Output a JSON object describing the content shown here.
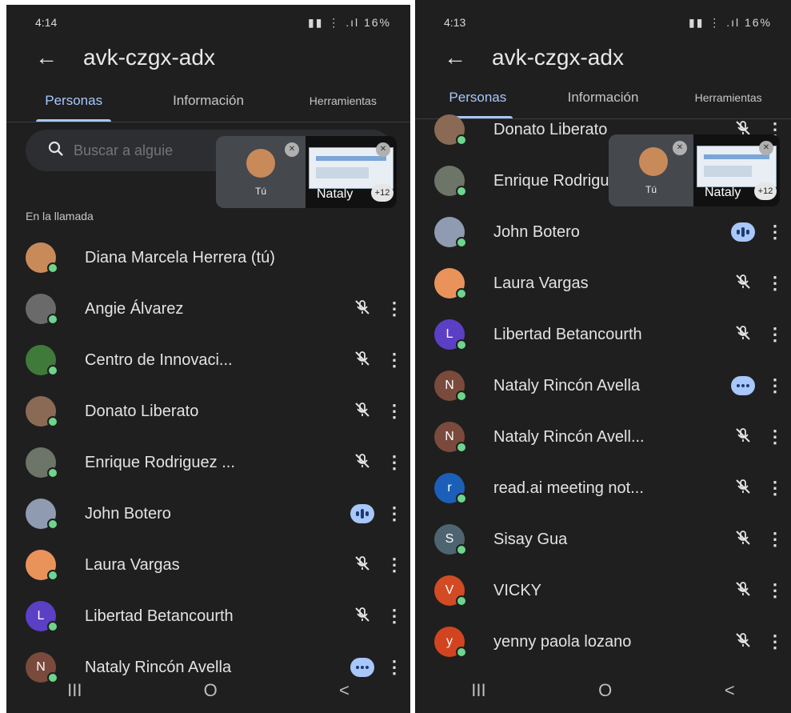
{
  "left": {
    "status": {
      "time": "4:14",
      "battery": "16%"
    },
    "title": "avk-czgx-adx",
    "tabs": [
      "Personas",
      "Información",
      "Herramientas"
    ],
    "search": {
      "placeholder": "Buscar a alguie"
    },
    "pip": {
      "self_label": "Tú",
      "share_name": "Nataly",
      "count": "+12"
    },
    "section_label": "En la llamada",
    "participants": [
      {
        "name": "Diana Marcela Herrera (tú)",
        "initial": "",
        "color": "#c98a5a",
        "state": "none"
      },
      {
        "name": "Angie Álvarez",
        "initial": "",
        "color": "#6a6a6a",
        "state": "muted"
      },
      {
        "name": "Centro de Innovaci...",
        "initial": "",
        "color": "#3f7a3a",
        "state": "muted"
      },
      {
        "name": "Donato Liberato",
        "initial": "",
        "color": "#8a6a55",
        "state": "muted"
      },
      {
        "name": "Enrique Rodriguez ...",
        "initial": "",
        "color": "#6d7468",
        "state": "muted"
      },
      {
        "name": "John Botero",
        "initial": "",
        "color": "#8f9bb0",
        "state": "speaking"
      },
      {
        "name": "Laura Vargas",
        "initial": "",
        "color": "#e9935b",
        "state": "muted"
      },
      {
        "name": "Libertad Betancourth",
        "initial": "L",
        "color": "#5b3fc4",
        "state": "muted"
      },
      {
        "name": "Nataly Rincón Avella",
        "initial": "N",
        "color": "#7a4a3c",
        "state": "more"
      }
    ]
  },
  "right": {
    "status": {
      "time": "4:13",
      "battery": "16%"
    },
    "title": "avk-czgx-adx",
    "tabs": [
      "Personas",
      "Información",
      "Herramientas"
    ],
    "pip": {
      "self_label": "Tú",
      "share_name": "Nataly",
      "count": "+12"
    },
    "participants": [
      {
        "name": "Donato Liberato",
        "initial": "",
        "color": "#8a6a55",
        "state": "muted"
      },
      {
        "name": "Enrique Rodriguez",
        "initial": "",
        "color": "#6d7468",
        "state": "none"
      },
      {
        "name": "John Botero",
        "initial": "",
        "color": "#8f9bb0",
        "state": "speaking"
      },
      {
        "name": "Laura Vargas",
        "initial": "",
        "color": "#e9935b",
        "state": "muted"
      },
      {
        "name": "Libertad Betancourth",
        "initial": "L",
        "color": "#5b3fc4",
        "state": "muted"
      },
      {
        "name": "Nataly Rincón Avella",
        "initial": "N",
        "color": "#7a4a3c",
        "state": "more"
      },
      {
        "name": "Nataly Rincón Avell...",
        "initial": "N",
        "color": "#7a4a3c",
        "state": "muted"
      },
      {
        "name": "read.ai meeting not...",
        "initial": "r",
        "color": "#1b5fb8",
        "state": "muted"
      },
      {
        "name": "Sisay Gua",
        "initial": "S",
        "color": "#4e6470",
        "state": "muted"
      },
      {
        "name": "VICKY",
        "initial": "V",
        "color": "#d24b24",
        "state": "muted"
      },
      {
        "name": "yenny paola lozano",
        "initial": "y",
        "color": "#d2441f",
        "state": "muted"
      }
    ]
  },
  "nav": {
    "recents": "III",
    "home": "O",
    "back": "<"
  }
}
